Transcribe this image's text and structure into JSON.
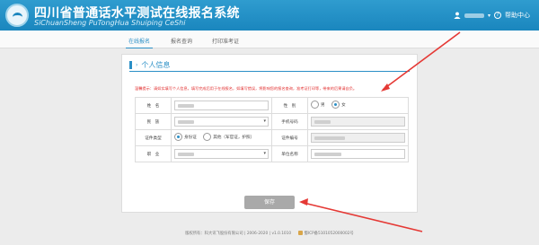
{
  "header": {
    "title_cn": "四川省普通话水平测试在线报名系统",
    "title_en": "SiChuanSheng PuTongHua Shuiping CeShi",
    "help_label": "帮助中心"
  },
  "nav": {
    "items": [
      "在线报名",
      "报名查询",
      "打印准考证"
    ],
    "active_index": 0
  },
  "panel": {
    "title": "个人信息",
    "notice": "温馨提示：请如实填写个人信息，填写完成后用于在线报名，如填写错误，将影响您的报名查询，准考证打印等，带来的后果请自负。"
  },
  "form": {
    "name_label": "姓　名",
    "gender_label": "性　别",
    "gender_options": [
      "男",
      "女"
    ],
    "ethnicity_label": "民　族",
    "phone_label": "手机号码",
    "id_type_label": "证件类型",
    "id_type_options": [
      "身份证",
      "其他（军官证，护照）"
    ],
    "id_number_label": "证件编号",
    "occupation_label": "职　业",
    "work_unit_label": "单位名称"
  },
  "actions": {
    "save_label": "保存"
  },
  "footer": {
    "copyright": "版权所有：",
    "company": "科大讯飞股份有限公司",
    "years": "2006-2020",
    "version": "v1.0.1010",
    "icp_prefix": "蜀ICP备",
    "icp_number": "5101052000002号"
  },
  "colors": {
    "header_blue": "#1a86be",
    "accent": "#2b8fc6",
    "notice_red": "#e23030",
    "annotation_red": "#e53935",
    "button_gray": "#a9a9a9"
  }
}
